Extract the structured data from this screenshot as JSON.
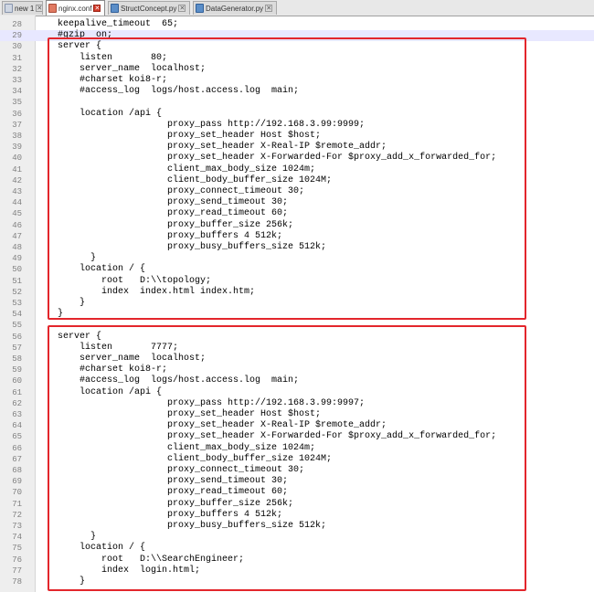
{
  "tabs": [
    {
      "label": "new 1",
      "icon": "text-file-icon",
      "active": false
    },
    {
      "label": "nginx.conf",
      "icon": "conf-file-icon",
      "active": true
    },
    {
      "label": "StructConcept.py",
      "icon": "python-file-icon",
      "active": false
    },
    {
      "label": "DataGenerator.py",
      "icon": "python-file-icon",
      "active": false
    }
  ],
  "editor": {
    "current_line": 29,
    "lines": [
      {
        "n": "28",
        "text": "keepalive_timeout  65;"
      },
      {
        "n": "29",
        "text": "#gzip  on;"
      },
      {
        "n": "30",
        "text": "server {"
      },
      {
        "n": "31",
        "text": "    listen       80;"
      },
      {
        "n": "32",
        "text": "    server_name  localhost;"
      },
      {
        "n": "33",
        "text": "    #charset koi8-r;"
      },
      {
        "n": "34",
        "text": "    #access_log  logs/host.access.log  main;"
      },
      {
        "n": "35",
        "text": ""
      },
      {
        "n": "36",
        "text": "    location /api {"
      },
      {
        "n": "37",
        "text": "                    proxy_pass http://192.168.3.99:9999;"
      },
      {
        "n": "38",
        "text": "                    proxy_set_header Host $host;"
      },
      {
        "n": "39",
        "text": "                    proxy_set_header X-Real-IP $remote_addr;"
      },
      {
        "n": "40",
        "text": "                    proxy_set_header X-Forwarded-For $proxy_add_x_forwarded_for;"
      },
      {
        "n": "41",
        "text": "                    client_max_body_size 1024m;"
      },
      {
        "n": "42",
        "text": "                    client_body_buffer_size 1024M;"
      },
      {
        "n": "43",
        "text": "                    proxy_connect_timeout 30;"
      },
      {
        "n": "44",
        "text": "                    proxy_send_timeout 30;"
      },
      {
        "n": "45",
        "text": "                    proxy_read_timeout 60;"
      },
      {
        "n": "46",
        "text": "                    proxy_buffer_size 256k;"
      },
      {
        "n": "47",
        "text": "                    proxy_buffers 4 512k;"
      },
      {
        "n": "48",
        "text": "                    proxy_busy_buffers_size 512k;"
      },
      {
        "n": "49",
        "text": "      }"
      },
      {
        "n": "50",
        "text": "    location / {"
      },
      {
        "n": "51",
        "text": "        root   D:\\\\topology;"
      },
      {
        "n": "52",
        "text": "        index  index.html index.htm;"
      },
      {
        "n": "53",
        "text": "    }"
      },
      {
        "n": "54",
        "text": "}"
      },
      {
        "n": "55",
        "text": ""
      },
      {
        "n": "56",
        "text": "server {"
      },
      {
        "n": "57",
        "text": "    listen       7777;"
      },
      {
        "n": "58",
        "text": "    server_name  localhost;"
      },
      {
        "n": "59",
        "text": "    #charset koi8-r;"
      },
      {
        "n": "60",
        "text": "    #access_log  logs/host.access.log  main;"
      },
      {
        "n": "61",
        "text": "    location /api {"
      },
      {
        "n": "62",
        "text": "                    proxy_pass http://192.168.3.99:9997;"
      },
      {
        "n": "63",
        "text": "                    proxy_set_header Host $host;"
      },
      {
        "n": "64",
        "text": "                    proxy_set_header X-Real-IP $remote_addr;"
      },
      {
        "n": "65",
        "text": "                    proxy_set_header X-Forwarded-For $proxy_add_x_forwarded_for;"
      },
      {
        "n": "66",
        "text": "                    client_max_body_size 1024m;"
      },
      {
        "n": "67",
        "text": "                    client_body_buffer_size 1024M;"
      },
      {
        "n": "68",
        "text": "                    proxy_connect_timeout 30;"
      },
      {
        "n": "69",
        "text": "                    proxy_send_timeout 30;"
      },
      {
        "n": "70",
        "text": "                    proxy_read_timeout 60;"
      },
      {
        "n": "71",
        "text": "                    proxy_buffer_size 256k;"
      },
      {
        "n": "72",
        "text": "                    proxy_buffers 4 512k;"
      },
      {
        "n": "73",
        "text": "                    proxy_busy_buffers_size 512k;"
      },
      {
        "n": "74",
        "text": "      }"
      },
      {
        "n": "75",
        "text": "    location / {"
      },
      {
        "n": "76",
        "text": "        root   D:\\\\SearchEngineer;"
      },
      {
        "n": "77",
        "text": "        index  login.html;"
      },
      {
        "n": "78",
        "text": "    }"
      }
    ]
  },
  "highlight_color": "#e3262c"
}
